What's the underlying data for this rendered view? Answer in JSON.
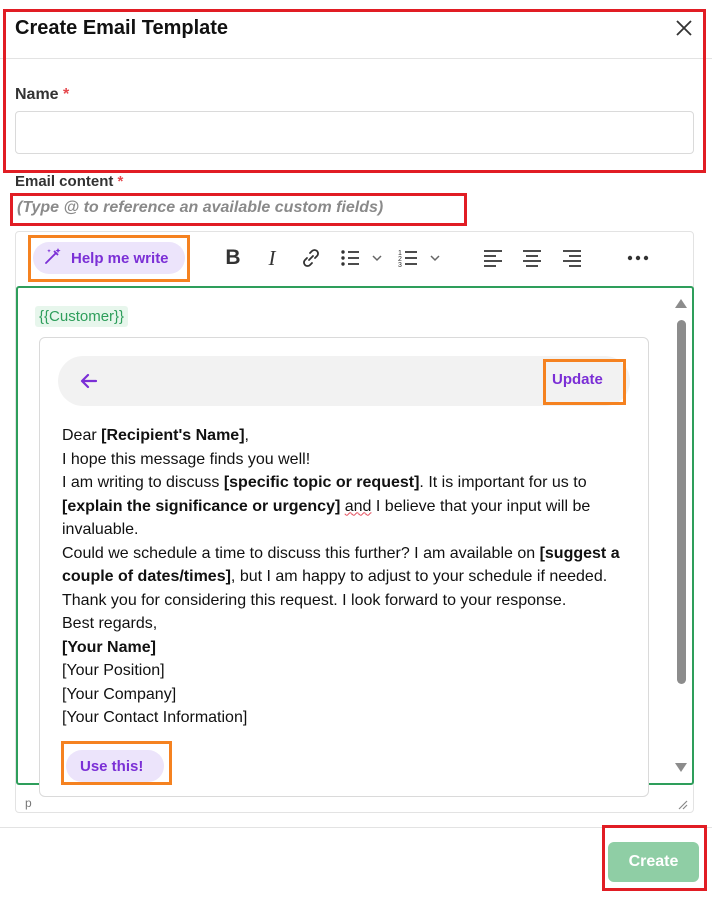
{
  "dialog": {
    "title": "Create Email Template"
  },
  "name_field": {
    "label": "Name",
    "required_mark": "*",
    "value": ""
  },
  "email_content": {
    "label": "Email content",
    "required_mark": "*",
    "hint": "(Type @ to reference an available custom fields)"
  },
  "toolbar": {
    "help_label": "Help me write",
    "buttons": [
      "magic-wand-icon",
      "bold-icon",
      "italic-icon",
      "link-icon",
      "bullet-list-icon",
      "numbered-list-icon",
      "align-left-icon",
      "align-center-icon",
      "align-right-icon",
      "more-icon"
    ]
  },
  "editor": {
    "chip": "{{Customer}}",
    "footer": "p",
    "border_color": "#2e9e5b"
  },
  "suggestion": {
    "update_label": "Update",
    "use_label": "Use this!",
    "lines": {
      "l1a": "Dear ",
      "l1b": "[Recipient's Name]",
      "l1c": ",",
      "l2": "I hope this message finds you well!",
      "l3a": "I am writing to discuss ",
      "l3b": "[specific topic or request]",
      "l3c": ". It is important for us to",
      "l4a": "[explain the significance or urgency]",
      "l4b": " ",
      "l4c": "and",
      "l4d": " I believe that your input will be invaluable.",
      "l5a": "Could we schedule a time to discuss this further? I am available on ",
      "l5b": "[suggest a couple of dates/times]",
      "l5c": ", but I am happy to adjust to your schedule if needed.",
      "l6": "Thank you for considering this request. I look forward to your response.",
      "l7": "Best regards,",
      "l8": "[Your Name]",
      "l9": "[Your Position]",
      "l10": "[Your Company]",
      "l11": "[Your Contact Information]"
    }
  },
  "footer": {
    "create_label": "Create"
  },
  "colors": {
    "accent_purple": "#7b2fd6",
    "create_green": "#8fcea5",
    "highlight_red": "#e11d24",
    "highlight_orange": "#f58220"
  }
}
